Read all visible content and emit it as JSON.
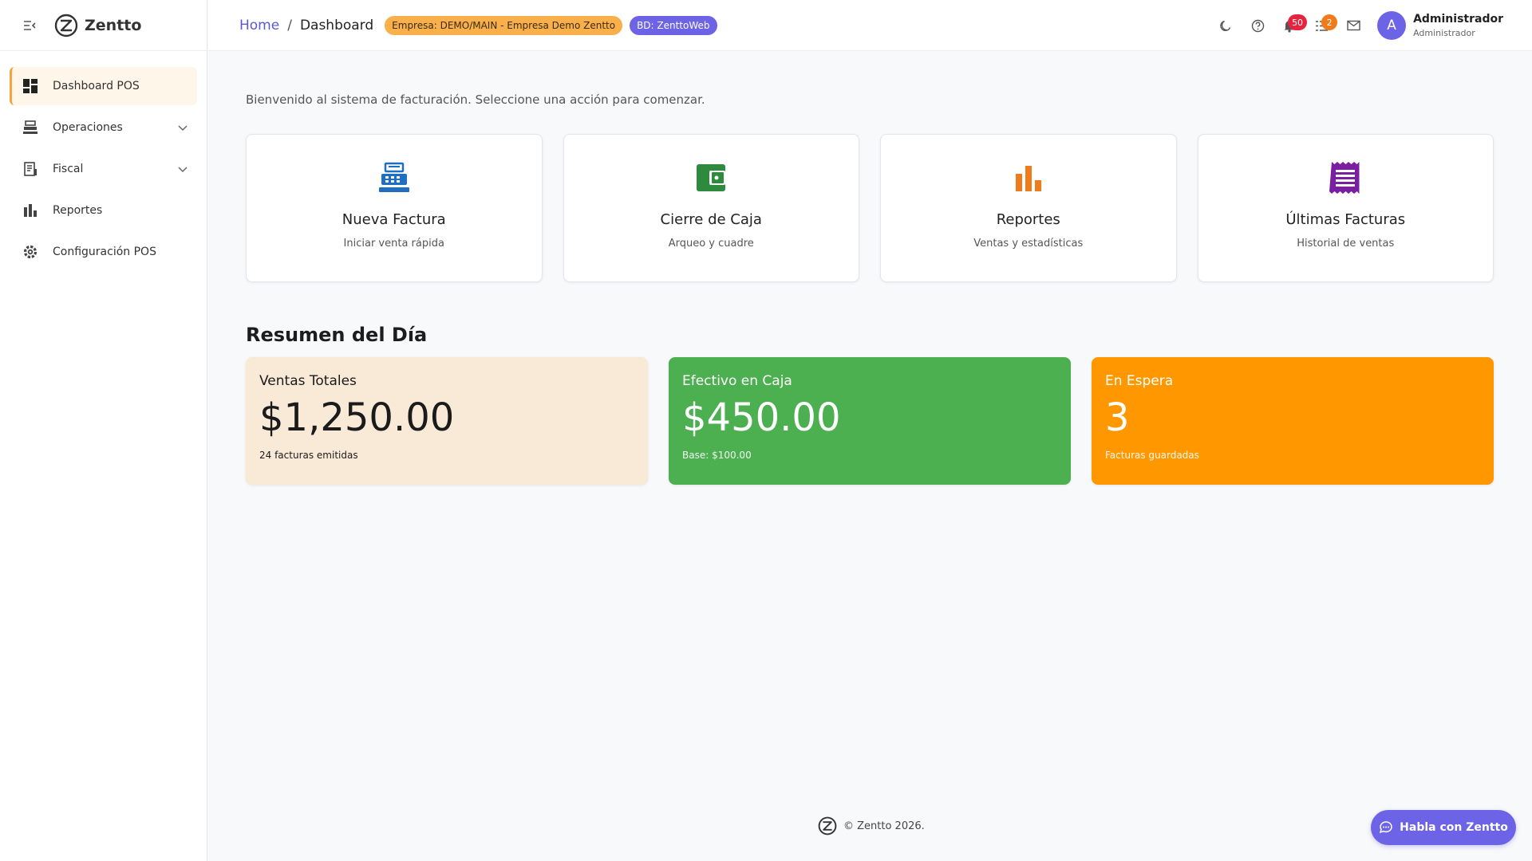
{
  "brand": {
    "name": "Zentto"
  },
  "sidebar": {
    "items": [
      {
        "label": "Dashboard POS"
      },
      {
        "label": "Operaciones"
      },
      {
        "label": "Fiscal"
      },
      {
        "label": "Reportes"
      },
      {
        "label": "Configuración POS"
      }
    ]
  },
  "header": {
    "breadcrumb_home": "Home",
    "breadcrumb_sep": "/",
    "breadcrumb_current": "Dashboard",
    "company_pill": "Empresa: DEMO/MAIN - Empresa Demo Zentto",
    "db_pill": "BD: ZenttoWeb",
    "notifications_count": "50",
    "tasks_count": "2",
    "avatar_initial": "A",
    "user_name": "Administrador",
    "user_role": "Administrador"
  },
  "main": {
    "welcome": "Bienvenido al sistema de facturación. Seleccione una acción para comenzar.",
    "actions": [
      {
        "title": "Nueva Factura",
        "subtitle": "Iniciar venta rápida",
        "icon": "cash-register-icon",
        "color": "#1e6fc2"
      },
      {
        "title": "Cierre de Caja",
        "subtitle": "Arqueo y cuadre",
        "icon": "wallet-icon",
        "color": "#2e8b3e"
      },
      {
        "title": "Reportes",
        "subtitle": "Ventas y estadísticas",
        "icon": "bar-chart-icon",
        "color": "#ef7b1a"
      },
      {
        "title": "Últimas Facturas",
        "subtitle": "Historial de ventas",
        "icon": "receipt-icon",
        "color": "#7b1fa2"
      }
    ],
    "summary_title": "Resumen del Día",
    "stats": [
      {
        "title": "Ventas Totales",
        "value": "$1,250.00",
        "sub": "24 facturas emitidas",
        "color": "#f9ead8"
      },
      {
        "title": "Efectivo en Caja",
        "value": "$450.00",
        "sub": "Base: $100.00",
        "color": "#4caf50"
      },
      {
        "title": "En Espera",
        "value": "3",
        "sub": "Facturas guardadas",
        "color": "#ff9800"
      }
    ]
  },
  "footer": {
    "text": "© Zentto 2026."
  },
  "chat": {
    "label": "Habla con Zentto"
  },
  "colors": {
    "accent": "#6c63e6",
    "active_nav": "#f4a340"
  }
}
